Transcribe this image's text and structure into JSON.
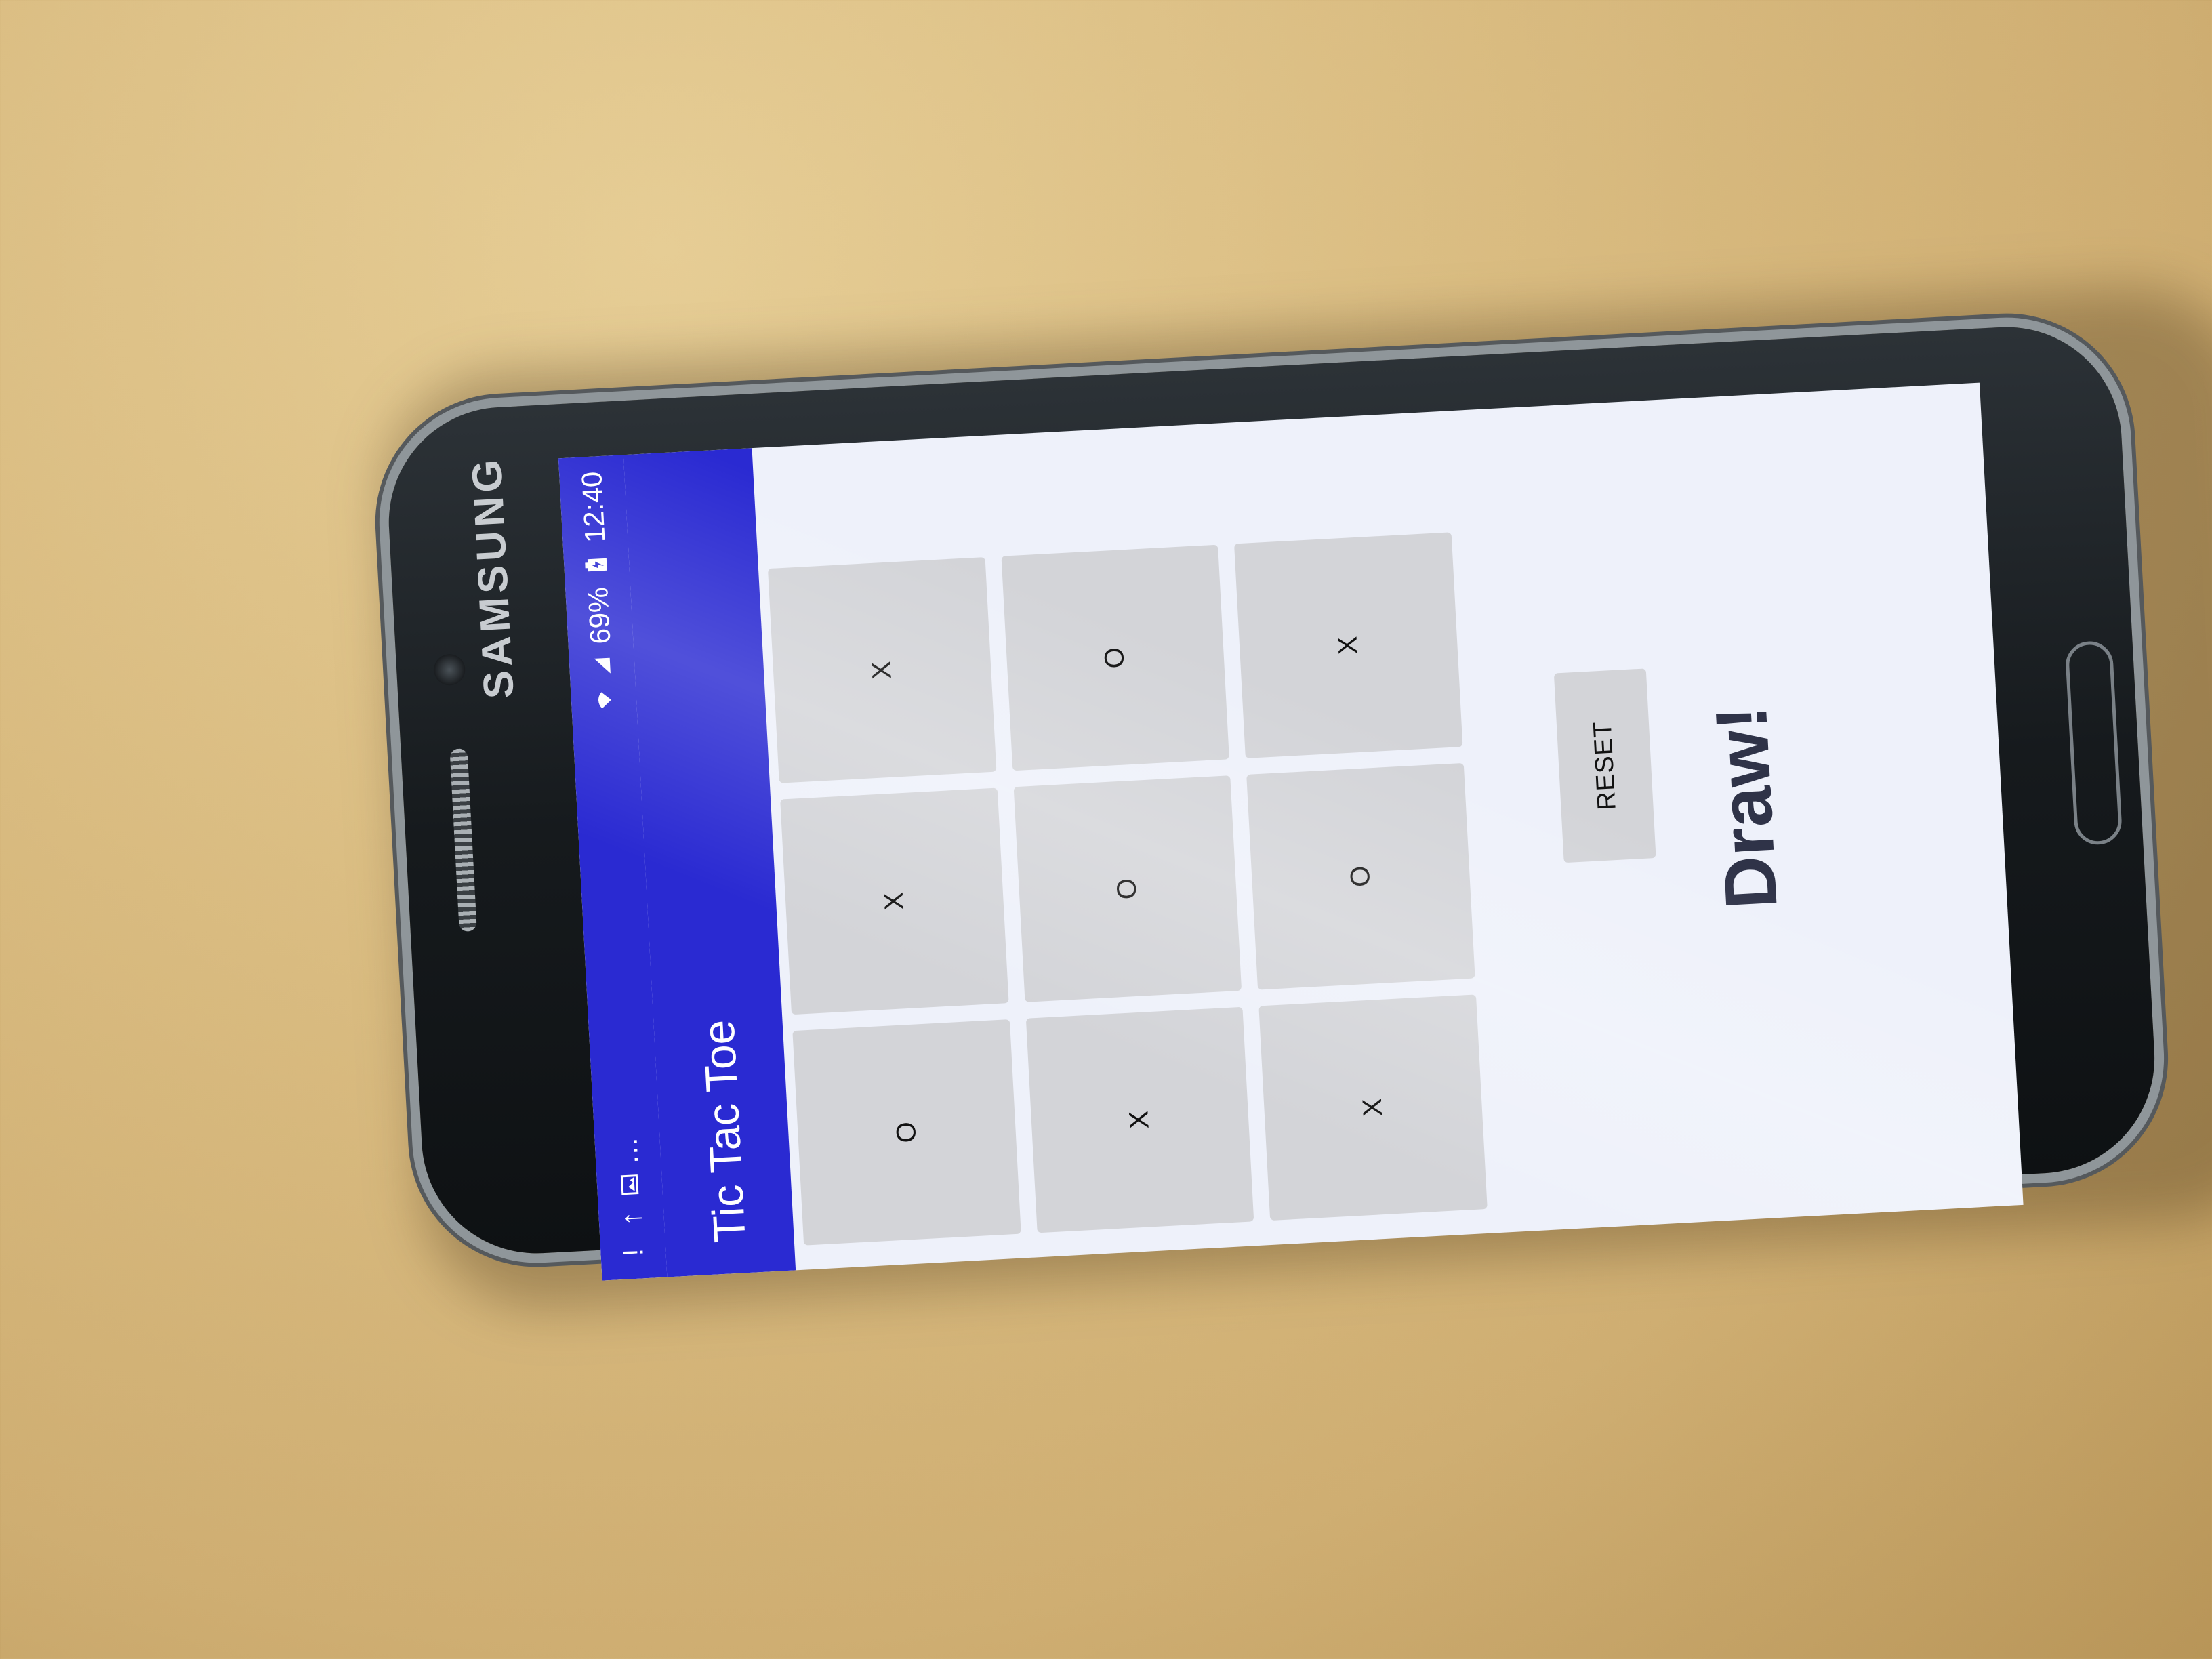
{
  "device": {
    "brand": "SAMSUNG"
  },
  "statusbar": {
    "notification_icons": [
      "!",
      "↑",
      "image-icon",
      "…"
    ],
    "battery": "69%",
    "time": "12:40"
  },
  "appbar": {
    "title": "Tic Tac Toe"
  },
  "board": {
    "cells": [
      "O",
      "X",
      "X",
      "X",
      "O",
      "O",
      "X",
      "O",
      "X"
    ]
  },
  "controls": {
    "reset_label": "RESET"
  },
  "result": {
    "message": "Draw!"
  },
  "colors": {
    "app_bar": "#2a2ad2",
    "cell": "#d3d4d8",
    "background": "#eef1fa"
  }
}
